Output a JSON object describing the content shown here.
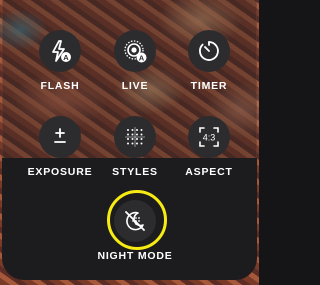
{
  "controls": {
    "flash": {
      "label": "FLASH",
      "icon": "flash-auto-icon"
    },
    "live": {
      "label": "LIVE",
      "icon": "live-photo-auto-icon"
    },
    "timer": {
      "label": "TIMER",
      "icon": "timer-icon"
    },
    "exposure": {
      "label": "EXPOSURE",
      "icon": "plus-minus-icon"
    },
    "styles": {
      "label": "STYLES",
      "icon": "dot-grid-icon"
    },
    "aspect": {
      "label": "ASPECT",
      "icon": "aspect-ratio-icon",
      "ratio_text": "4:3"
    },
    "night": {
      "label": "NIGHT MODE",
      "icon": "night-mode-off-icon"
    }
  },
  "colors": {
    "highlight_ring": "#f6eb12",
    "button_bg": "#2c2c2e",
    "label": "#ffffff"
  }
}
